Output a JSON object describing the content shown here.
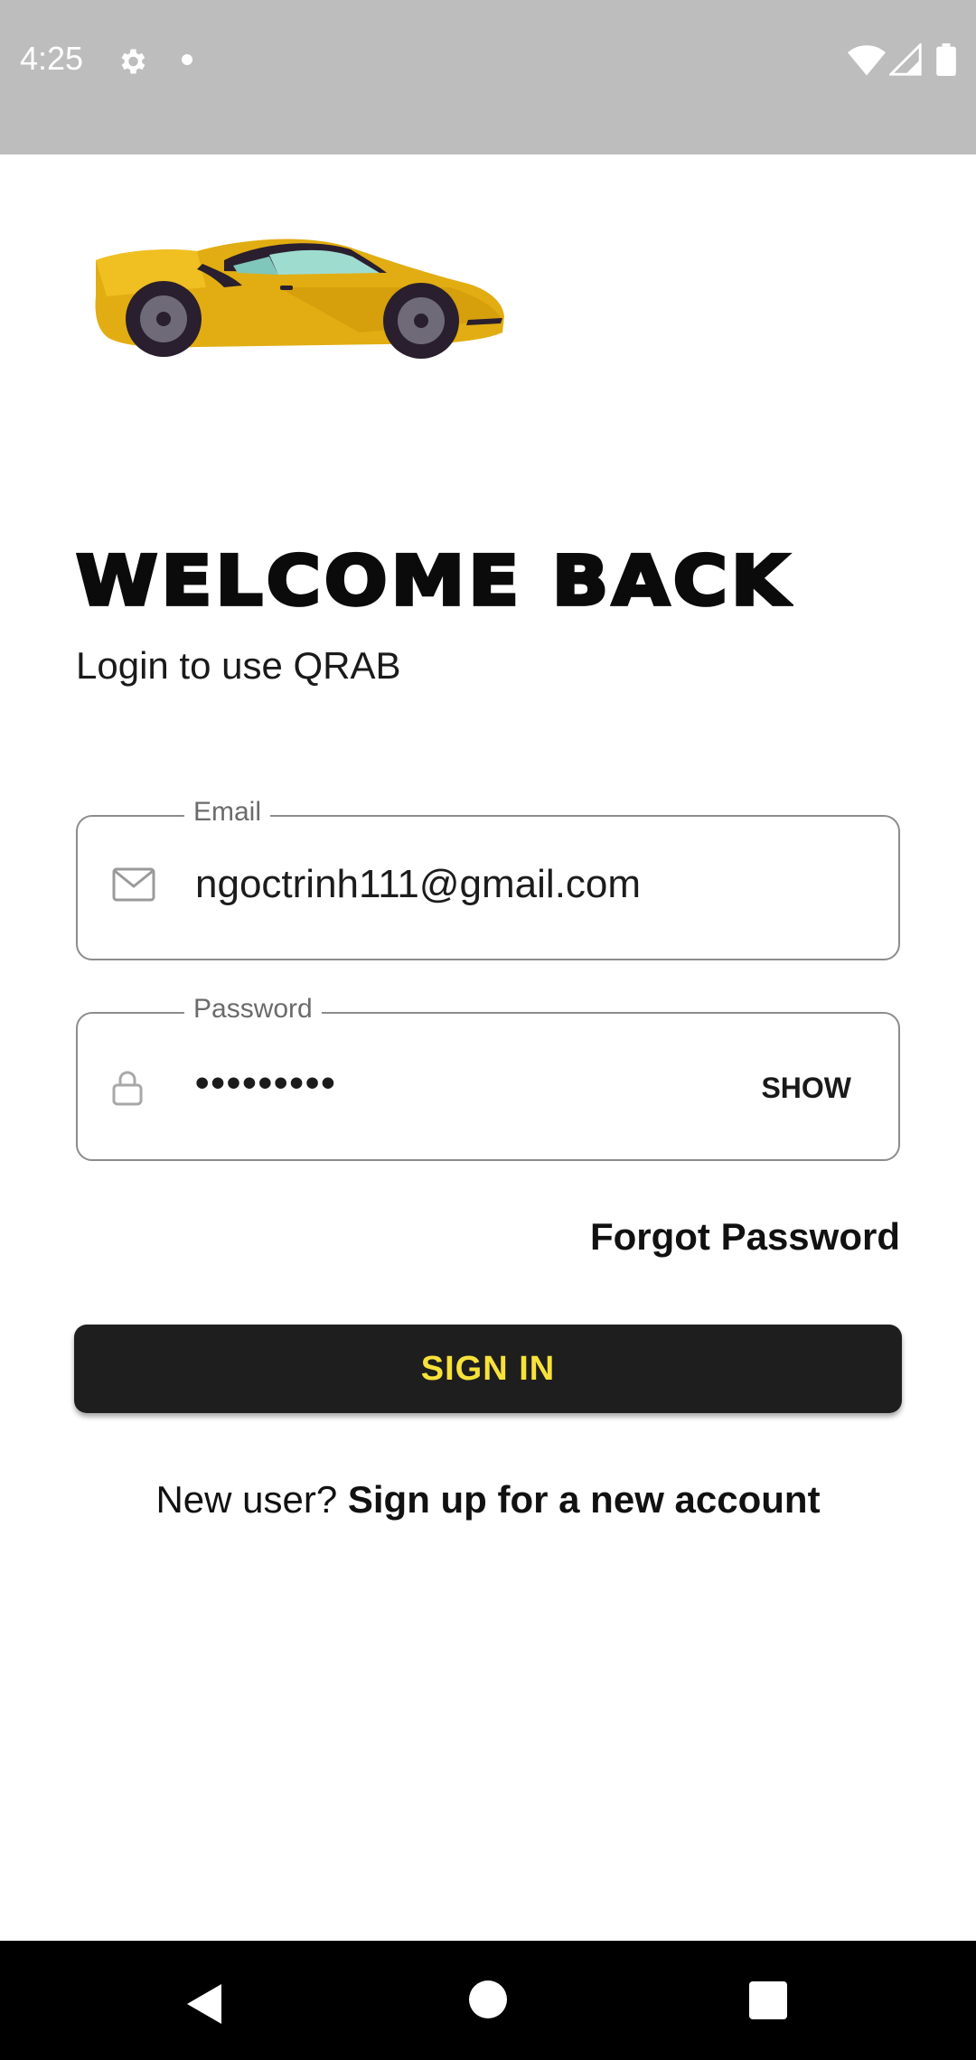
{
  "status_bar": {
    "time": "4:25",
    "icons": [
      "gear-icon",
      "notification-dot-icon",
      "wifi-icon",
      "signal-icon",
      "battery-icon"
    ]
  },
  "logo": {
    "icon": "sports-car-icon",
    "color": "#e2ad12"
  },
  "welcome": {
    "title": "WELCOME BACK",
    "subtitle": "Login to use QRAB"
  },
  "form": {
    "email": {
      "label": "Email",
      "value": "ngoctrinh111@gmail.com",
      "icon": "mail-icon"
    },
    "password": {
      "label": "Password",
      "value": "•••••••••",
      "icon": "lock-icon",
      "toggle_label": "SHOW"
    },
    "forgot_label": "Forgot Password",
    "signin_label": "SIGN IN",
    "signup_prefix": "New user?",
    "signup_link": "Sign up for a new account"
  },
  "nav_bar": {
    "icons": [
      "back-icon",
      "home-icon",
      "recents-icon"
    ]
  },
  "colors": {
    "status_bar": "#bdbdbd",
    "button_bg": "#1e1e1e",
    "button_text": "#f7e23a",
    "border": "#8c8c8c"
  }
}
